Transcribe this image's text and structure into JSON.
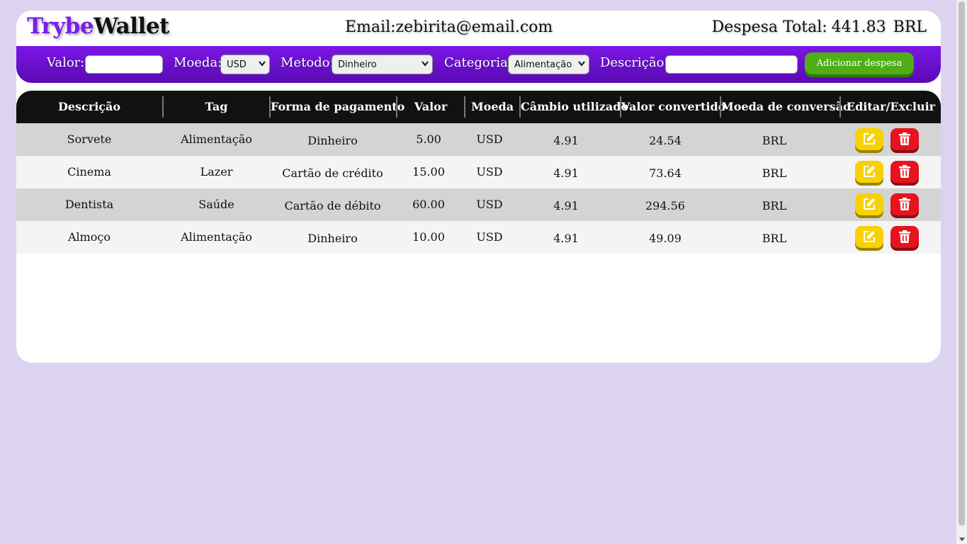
{
  "header": {
    "logo_part1": "Trybe",
    "logo_part2": "Wallet",
    "email": "Email:zebirita@email.com",
    "total_label": "Despesa Total:",
    "total_value": "441.83",
    "total_currency": "BRL"
  },
  "form": {
    "valor_label": "Valor:",
    "valor_value": "",
    "moeda_label": "Moeda:",
    "moeda_selected": "USD",
    "metodo_label": "Metodo:",
    "metodo_selected": "Dinheiro",
    "categoria_label": "Categoria:",
    "categoria_selected": "Alimentação",
    "descricao_label": "Descrição:",
    "descricao_value": "",
    "add_button": "Adicionar despesa"
  },
  "table": {
    "headers": [
      "Descrição",
      "Tag",
      "Forma de pagamento",
      "Valor",
      "Moeda",
      "Câmbio utilizado",
      "Valor convertido",
      "Moeda de conversão",
      "Editar/Excluir"
    ],
    "rows": [
      {
        "descricao": "Sorvete",
        "tag": "Alimentação",
        "forma": "Dinheiro",
        "valor": "5.00",
        "moeda": "USD",
        "cambio": "4.91",
        "convertido": "24.54",
        "conversao": "BRL"
      },
      {
        "descricao": "Cinema",
        "tag": "Lazer",
        "forma": "Cartão de crédito",
        "valor": "15.00",
        "moeda": "USD",
        "cambio": "4.91",
        "convertido": "73.64",
        "conversao": "BRL"
      },
      {
        "descricao": "Dentista",
        "tag": "Saúde",
        "forma": "Cartão de débito",
        "valor": "60.00",
        "moeda": "USD",
        "cambio": "4.91",
        "convertido": "294.56",
        "conversao": "BRL"
      },
      {
        "descricao": "Almoço",
        "tag": "Alimentação",
        "forma": "Dinheiro",
        "valor": "10.00",
        "moeda": "USD",
        "cambio": "4.91",
        "convertido": "49.09",
        "conversao": "BRL"
      }
    ]
  },
  "icons": {
    "edit": "edit-icon",
    "delete": "trash-icon"
  },
  "colors": {
    "background": "#dcd3f1",
    "accent": "#7a16e6",
    "add_button": "#4fae16",
    "edit_button": "#f7d200",
    "delete_button": "#e5141f",
    "table_header": "#111111"
  }
}
